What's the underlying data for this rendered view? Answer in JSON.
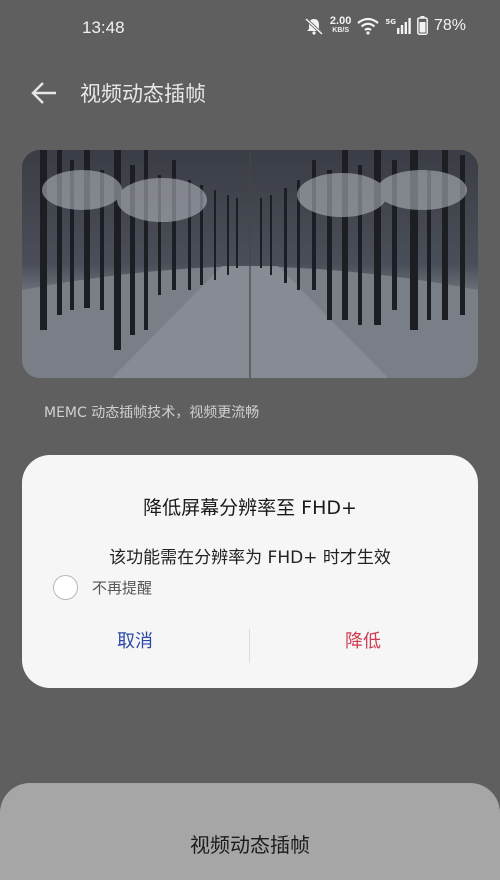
{
  "status_bar": {
    "time": "13:48",
    "net_speed_value": "2.00",
    "net_speed_unit": "KB/S",
    "network": "5G",
    "battery": "78%",
    "icons": [
      "silent-icon",
      "wifi-icon",
      "cellular-signal-icon",
      "battery-icon"
    ]
  },
  "header": {
    "title": "视频动态插帧",
    "back_icon": "back-arrow-icon"
  },
  "preview": {
    "description": "MEMC 动态插帧技术，视频更流畅"
  },
  "dialog": {
    "title": "降低屏幕分辨率至 FHD+",
    "message": "该功能需在分辨率为 FHD+ 时才生效",
    "checkbox_label": "不再提醒",
    "checkbox_checked": false,
    "cancel_label": "取消",
    "confirm_label": "降低",
    "colors": {
      "cancel": "#2b4aa8",
      "confirm": "#cf3b52"
    }
  },
  "bottom_sheet": {
    "title": "视频动态插帧"
  }
}
